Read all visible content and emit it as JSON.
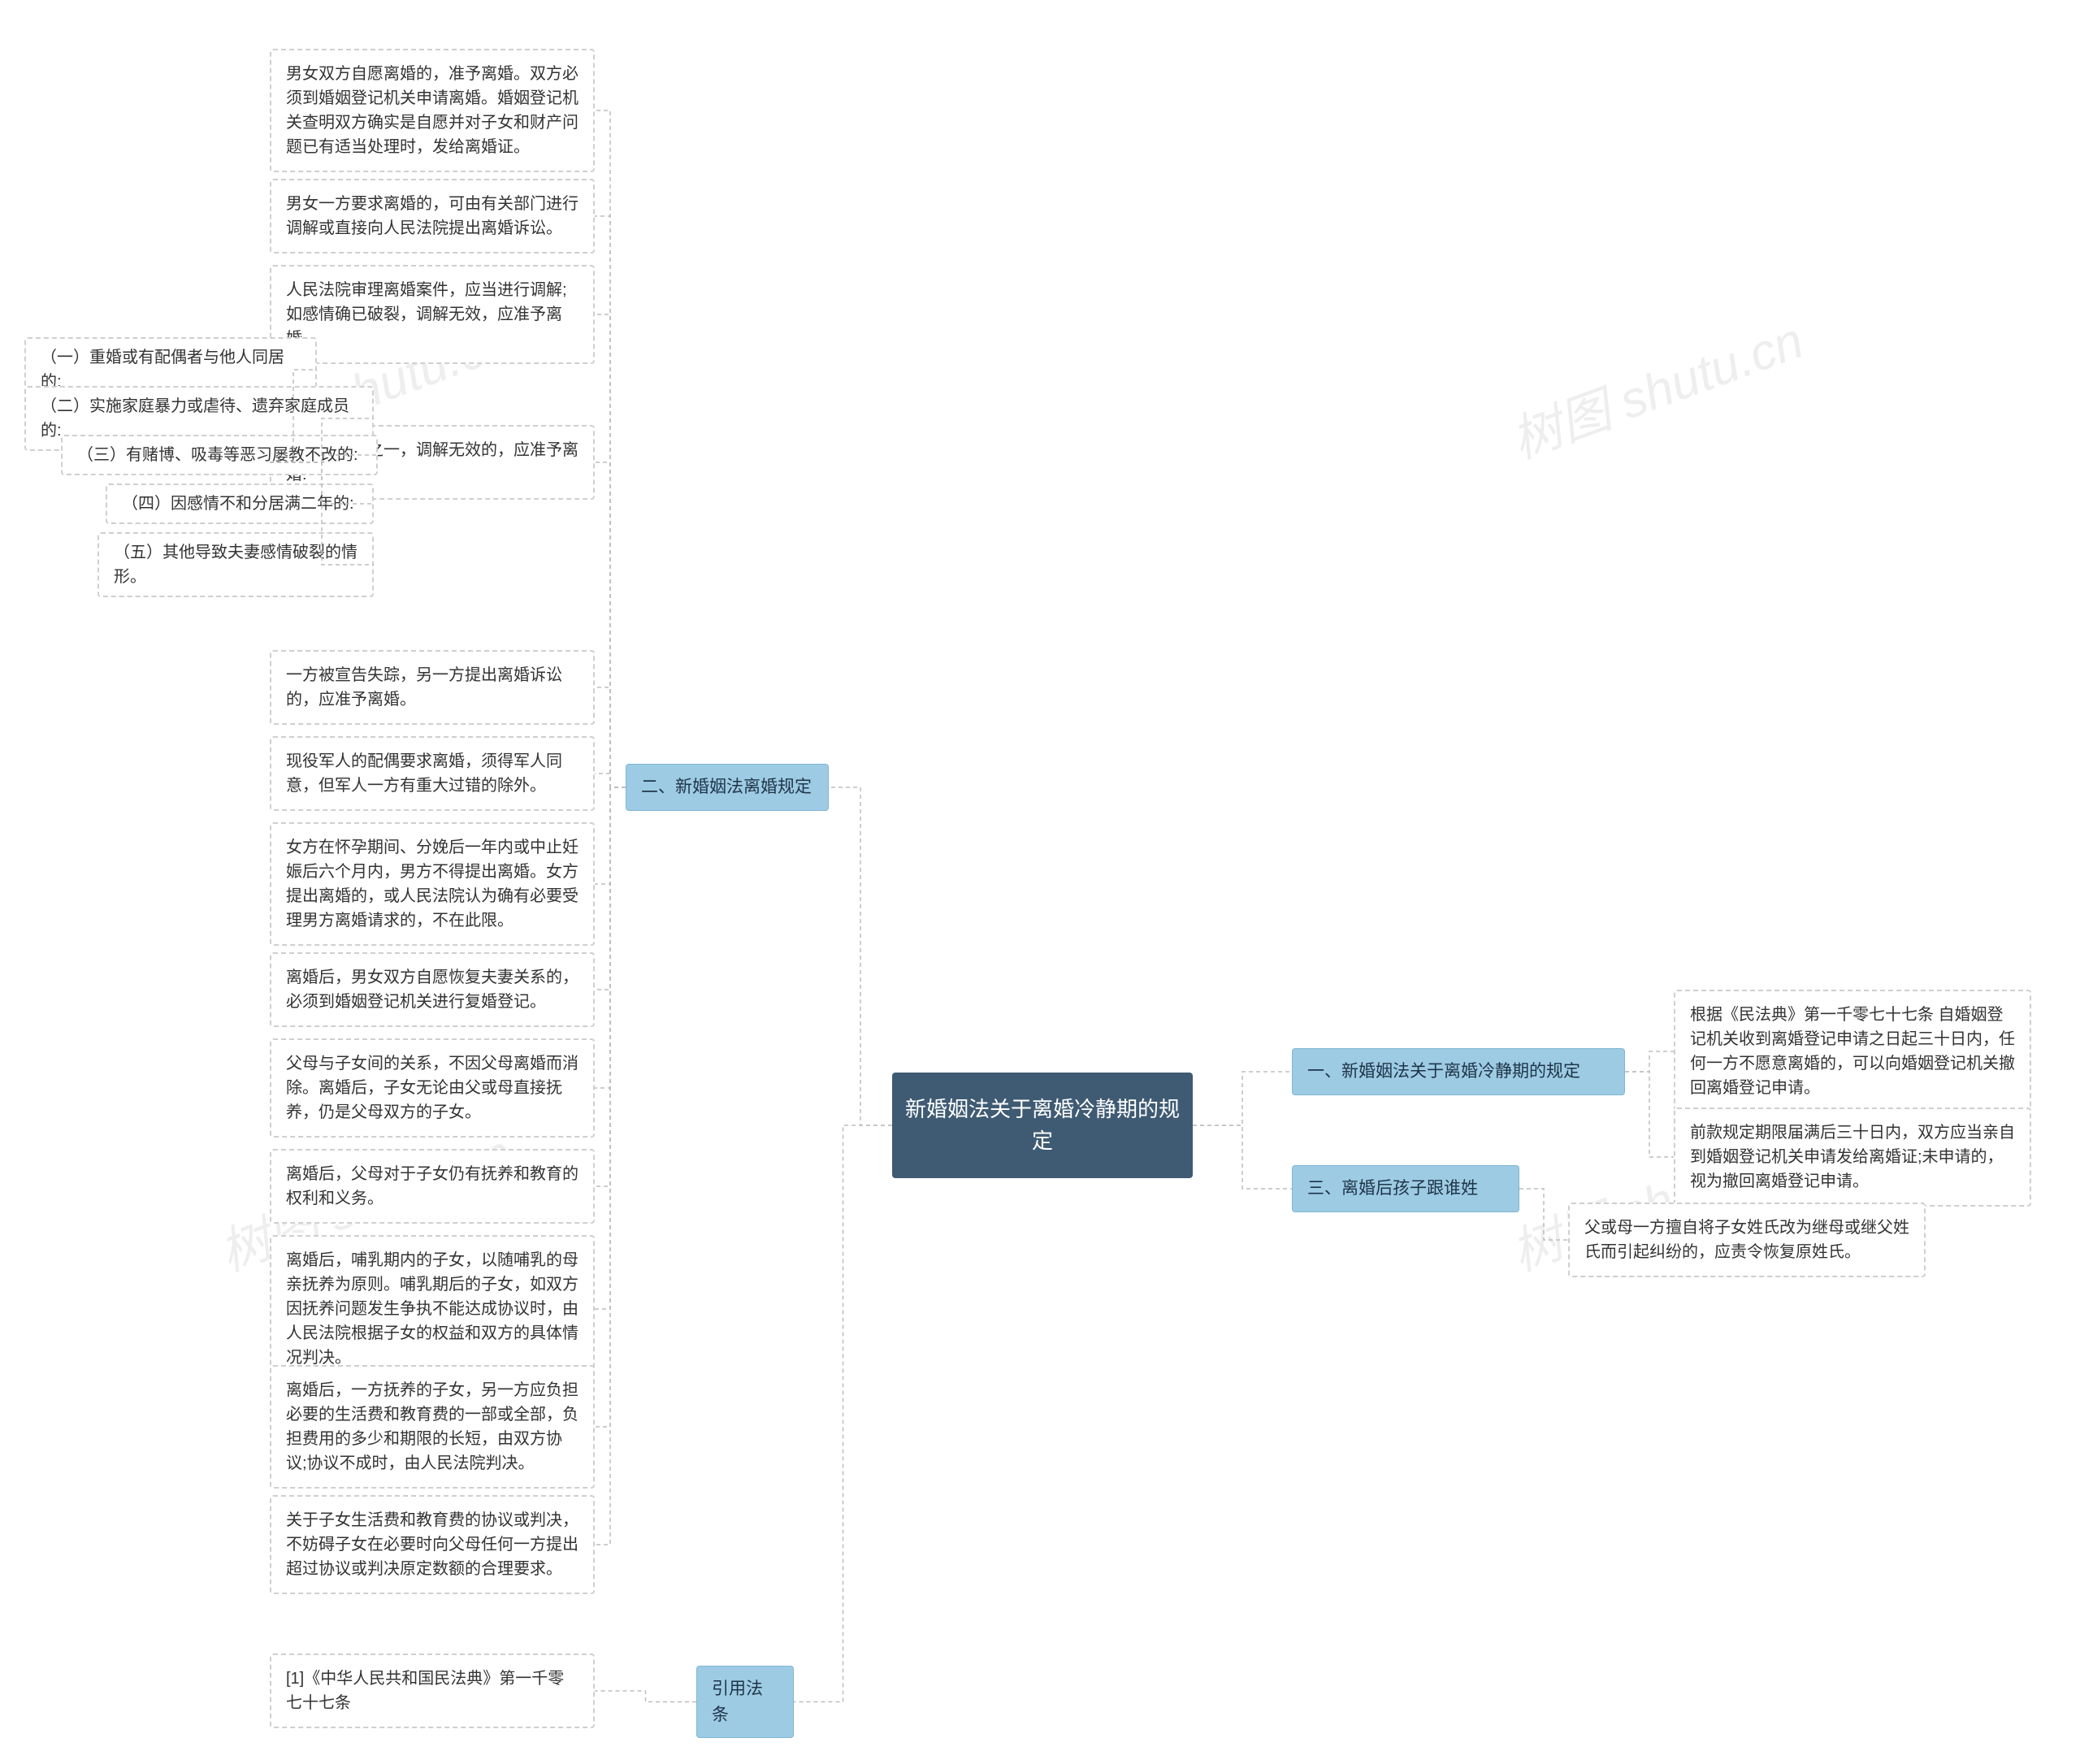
{
  "root": {
    "title": "新婚姻法关于离婚冷静期的规定"
  },
  "branches": {
    "section1": {
      "title": "一、新婚姻法关于离婚冷静期的规定",
      "leaves": [
        "根据《民法典》第一千零七十七条 自婚姻登记机关收到离婚登记申请之日起三十日内，任何一方不愿意离婚的，可以向婚姻登记机关撤回离婚登记申请。",
        "前款规定期限届满后三十日内，双方应当亲自到婚姻登记机关申请发给离婚证;未申请的，视为撤回离婚登记申请。"
      ]
    },
    "section3": {
      "title": "三、离婚后孩子跟谁姓",
      "leaves": [
        "父或母一方擅自将子女姓氏改为继母或继父姓氏而引起纠纷的，应责令恢复原姓氏。"
      ]
    },
    "section2": {
      "title": "二、新婚姻法离婚规定",
      "leaves": [
        "男女双方自愿离婚的，准予离婚。双方必须到婚姻登记机关申请离婚。婚姻登记机关查明双方确实是自愿并对子女和财产问题已有适当处理时，发给离婚证。",
        "男女一方要求离婚的，可由有关部门进行调解或直接向人民法院提出离婚诉讼。",
        "人民法院审理离婚案件，应当进行调解;如感情确已破裂，调解无效，应准予离婚。",
        "有下列情形之一，调解无效的，应准予离婚:",
        "一方被宣告失踪，另一方提出离婚诉讼的，应准予离婚。",
        "现役军人的配偶要求离婚，须得军人同意，但军人一方有重大过错的除外。",
        "女方在怀孕期间、分娩后一年内或中止妊娠后六个月内，男方不得提出离婚。女方提出离婚的，或人民法院认为确有必要受理男方离婚请求的，不在此限。",
        "离婚后，男女双方自愿恢复夫妻关系的，必须到婚姻登记机关进行复婚登记。",
        "父母与子女间的关系，不因父母离婚而消除。离婚后，子女无论由父或母直接抚养，仍是父母双方的子女。",
        "离婚后，父母对于子女仍有抚养和教育的权利和义务。",
        "离婚后，哺乳期内的子女，以随哺乳的母亲抚养为原则。哺乳期后的子女，如双方因抚养问题发生争执不能达成协议时，由人民法院根据子女的权益和双方的具体情况判决。",
        "离婚后，一方抚养的子女，另一方应负担必要的生活费和教育费的一部或全部，负担费用的多少和期限的长短，由双方协议;协议不成时，由人民法院判决。",
        "关于子女生活费和教育费的协议或判决，不妨碍子女在必要时向父母任何一方提出超过协议或判决原定数额的合理要求。"
      ],
      "sub4": {
        "items": [
          "（一）重婚或有配偶者与他人同居的:",
          "（二）实施家庭暴力或虐待、遗弃家庭成员的:",
          "（三）有赌博、吸毒等恶习屡教不改的:",
          "（四）因感情不和分居满二年的:",
          "（五）其他导致夫妻感情破裂的情形。"
        ]
      }
    },
    "citation": {
      "title": "引用法条",
      "leaves": [
        "[1]《中华人民共和国民法典》第一千零七十七条"
      ]
    }
  },
  "watermark": "树图 shutu.cn"
}
